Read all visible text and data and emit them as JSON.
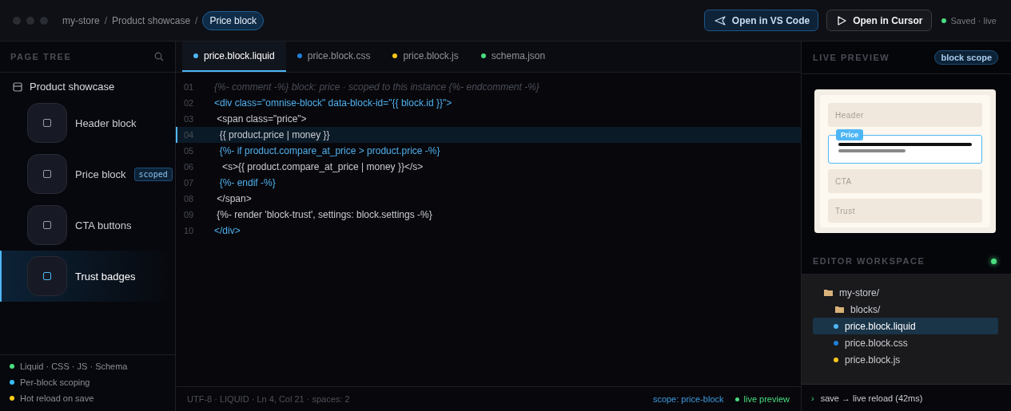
{
  "titlebar": {
    "breadcrumbs": [
      {
        "label": "my-store",
        "current": false
      },
      {
        "label": "Product showcase",
        "current": false
      },
      {
        "label": "Price block",
        "current": true
      }
    ],
    "separator": "/",
    "buttons": [
      {
        "label": "Open in VS Code",
        "kind": "primary"
      },
      {
        "label": "Open in Cursor",
        "kind": "secondary"
      }
    ],
    "status": "Saved · live"
  },
  "page_tree": {
    "title": "PAGE TREE",
    "root": "Product showcase",
    "items": [
      {
        "label": "Header block",
        "selected": false
      },
      {
        "label": "Price block",
        "selected": false,
        "badge": "scoped"
      },
      {
        "label": "CTA buttons",
        "selected": false
      },
      {
        "label": "Trust badges",
        "selected": true
      }
    ],
    "legend": [
      {
        "label": "Liquid · CSS · JS · Schema",
        "color": "#4ade80"
      },
      {
        "label": "Per-block scoping",
        "color": "#38bdf8"
      },
      {
        "label": "Hot reload on save",
        "color": "#facc15"
      }
    ]
  },
  "editor": {
    "tabs": [
      {
        "label": "price.block.liquid",
        "color": "#4fb6f5",
        "selected": true
      },
      {
        "label": "price.block.css",
        "color": "#1f7fd6",
        "selected": false
      },
      {
        "label": "price.block.js",
        "color": "#f5c518",
        "selected": false
      },
      {
        "label": "schema.json",
        "color": "#4ade80",
        "selected": false
      }
    ],
    "lines": [
      {
        "number": "01",
        "text": "{%- comment -%} block: price · scoped to this instance {%- endcomment -%}",
        "kind": "comment",
        "highlighted": false
      },
      {
        "number": "02",
        "text": "<div class=\"omnise-block\" data-block-id=\"{{ block.id }}\">",
        "kind": "accent",
        "highlighted": false
      },
      {
        "number": "03",
        "text": " <span class=\"price\">",
        "kind": "plain",
        "highlighted": false
      },
      {
        "number": "04",
        "text": "  {{ product.price | money }}",
        "kind": "plain",
        "highlighted": true
      },
      {
        "number": "05",
        "text": "  {%- if product.compare_at_price > product.price -%}",
        "kind": "accent",
        "highlighted": false
      },
      {
        "number": "06",
        "text": "   <s>{{ product.compare_at_price | money }}</s>",
        "kind": "plain",
        "highlighted": false
      },
      {
        "number": "07",
        "text": "  {%- endif -%}",
        "kind": "accent",
        "highlighted": false
      },
      {
        "number": "08",
        "text": " </span>",
        "kind": "plain",
        "highlighted": false
      },
      {
        "number": "09",
        "text": " {%- render 'block-trust', settings: block.settings -%}",
        "kind": "plain",
        "highlighted": false
      },
      {
        "number": "10",
        "text": "</div>",
        "kind": "accent",
        "highlighted": false
      }
    ],
    "status_left": "UTF-8 · LIQUID · Ln 4, Col 21 · spaces: 2",
    "scope": "scope: price-block",
    "live": "live preview"
  },
  "preview": {
    "title": "LIVE PREVIEW",
    "badge": "block scope",
    "sections": [
      {
        "label": "Header",
        "kind": "placeholder"
      },
      {
        "label": "Price",
        "kind": "active"
      },
      {
        "label": "CTA",
        "kind": "placeholder"
      },
      {
        "label": "Trust",
        "kind": "placeholder"
      }
    ]
  },
  "workspace": {
    "title": "EDITOR WORKSPACE",
    "tree": [
      {
        "label": "my-store/",
        "kind": "folder",
        "children": [
          {
            "label": "blocks/",
            "kind": "folder",
            "children": [
              {
                "label": "price.block.liquid",
                "kind": "file",
                "color": "#4fb6f5",
                "selected": true
              },
              {
                "label": "price.block.css",
                "kind": "file",
                "color": "#1f7fd6",
                "selected": false
              },
              {
                "label": "price.block.js",
                "kind": "file",
                "color": "#f5c518",
                "selected": false
              }
            ]
          }
        ]
      }
    ],
    "prompt": "›",
    "console": "save → live reload (42ms)"
  }
}
